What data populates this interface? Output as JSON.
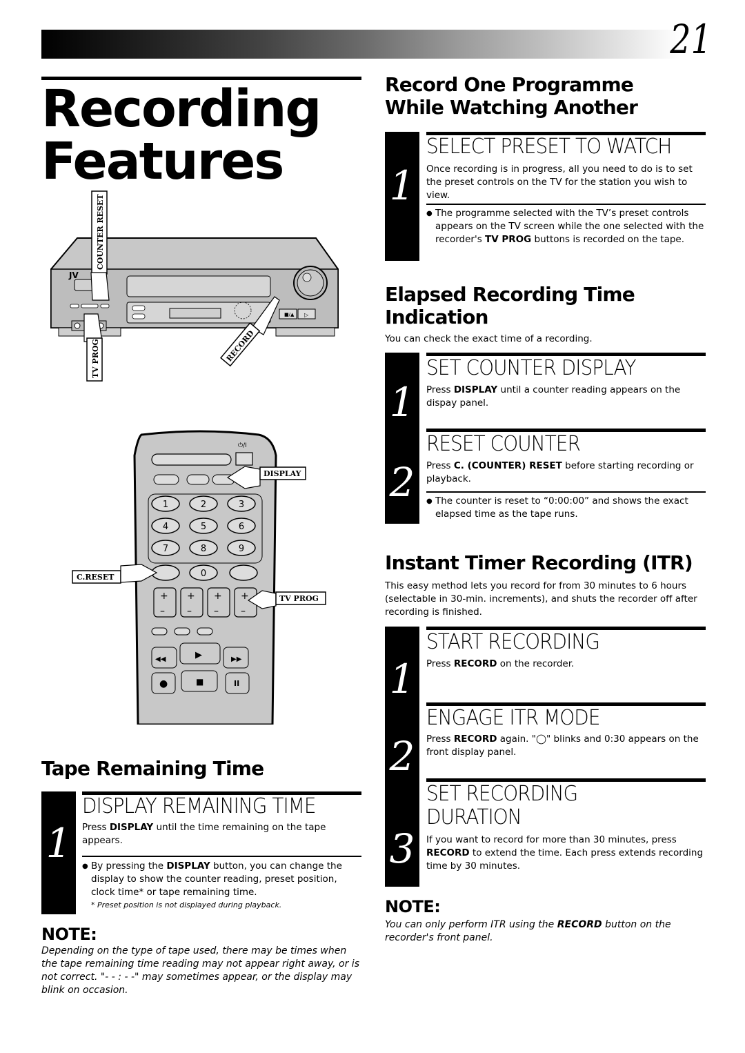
{
  "page": {
    "number": "21",
    "title_line1": "Recording",
    "title_line2": "Features"
  },
  "illustration_vcr": {
    "labels": {
      "counter_reset": "COUNTER RESET",
      "tv_prog": "TV PROG",
      "record": "RECORD",
      "brand": "JV"
    }
  },
  "illustration_remote": {
    "labels": {
      "display": "DISPLAY",
      "c_reset": "C.RESET",
      "tv_prog": "TV PROG"
    },
    "keypad": [
      "1",
      "2",
      "3",
      "4",
      "5",
      "6",
      "7",
      "8",
      "9",
      "0"
    ]
  },
  "sections": {
    "record_one": {
      "heading_line1": "Record One Programme",
      "heading_line2": "While Watching Another",
      "steps": [
        {
          "number": "1",
          "title": "SELECT PRESET TO WATCH",
          "text": "Once recording is in progress, all you need to do is to set the preset controls on the TV for the station you wish to view.",
          "bullet_pre": "The programme selected with the TV’s preset controls appears on the TV screen while the one selected with the recorder's ",
          "bullet_bold": "TV PROG",
          "bullet_post": " buttons is recorded on the tape."
        }
      ]
    },
    "elapsed": {
      "heading_line1": "Elapsed Recording Time",
      "heading_line2": "Indication",
      "intro": "You can check the exact time of a recording.",
      "steps": [
        {
          "number": "1",
          "title": "SET COUNTER DISPLAY",
          "text_pre": "Press ",
          "text_bold": "DISPLAY",
          "text_post": " until a counter reading appears on the dispay panel."
        },
        {
          "number": "2",
          "title": "RESET COUNTER",
          "text_pre": "Press ",
          "text_bold": "C. (COUNTER) RESET",
          "text_post": " before starting recording or playback.",
          "bullet": "The counter is reset to “0:00:00” and shows the exact elapsed time as the tape runs."
        }
      ]
    },
    "itr": {
      "heading": "Instant Timer Recording (ITR)",
      "intro": "This easy method lets you record for from 30 minutes to 6 hours (selectable in 30-min. increments), and shuts the recorder off after recording is finished.",
      "steps": [
        {
          "number": "1",
          "title": "START RECORDING",
          "text_pre": "Press ",
          "text_bold": "RECORD",
          "text_post": " on the recorder."
        },
        {
          "number": "2",
          "title": "ENGAGE ITR MODE",
          "text_pre": "Press ",
          "text_bold": "RECORD",
          "text_post": " again. \"◯\" blinks and 0:30 appears on the front display panel."
        },
        {
          "number": "3",
          "title_line1": "SET RECORDING",
          "title_line2": "DURATION",
          "text_pre": "If you want to record for more than 30 minutes, press ",
          "text_bold": "RECORD",
          "text_post": " to extend the time. Each press extends recording time by 30 minutes."
        }
      ],
      "note_heading": "NOTE:",
      "note_pre": "You can only perform ITR using the ",
      "note_bold": "RECORD",
      "note_post": " button on the recorder's front panel."
    },
    "tape_remaining": {
      "heading": "Tape Remaining Time",
      "steps": [
        {
          "number": "1",
          "title": "DISPLAY REMAINING TIME",
          "text_pre": "Press ",
          "text_bold": "DISPLAY",
          "text_post": " until the time remaining on the tape appears.",
          "bullet_pre": "By pressing the ",
          "bullet_bold": "DISPLAY",
          "bullet_post": " button, you can change the display to show the counter reading, preset position, clock time* or tape remaining time.",
          "footnote": "* Preset position is not displayed during playback."
        }
      ],
      "note_heading": "NOTE:",
      "note_text": "Depending on the type of tape used, there may be times when the tape remaining time reading may not appear right away, or is not correct. \"- - : - -\" may sometimes appear, or the display may blink on occasion."
    }
  }
}
